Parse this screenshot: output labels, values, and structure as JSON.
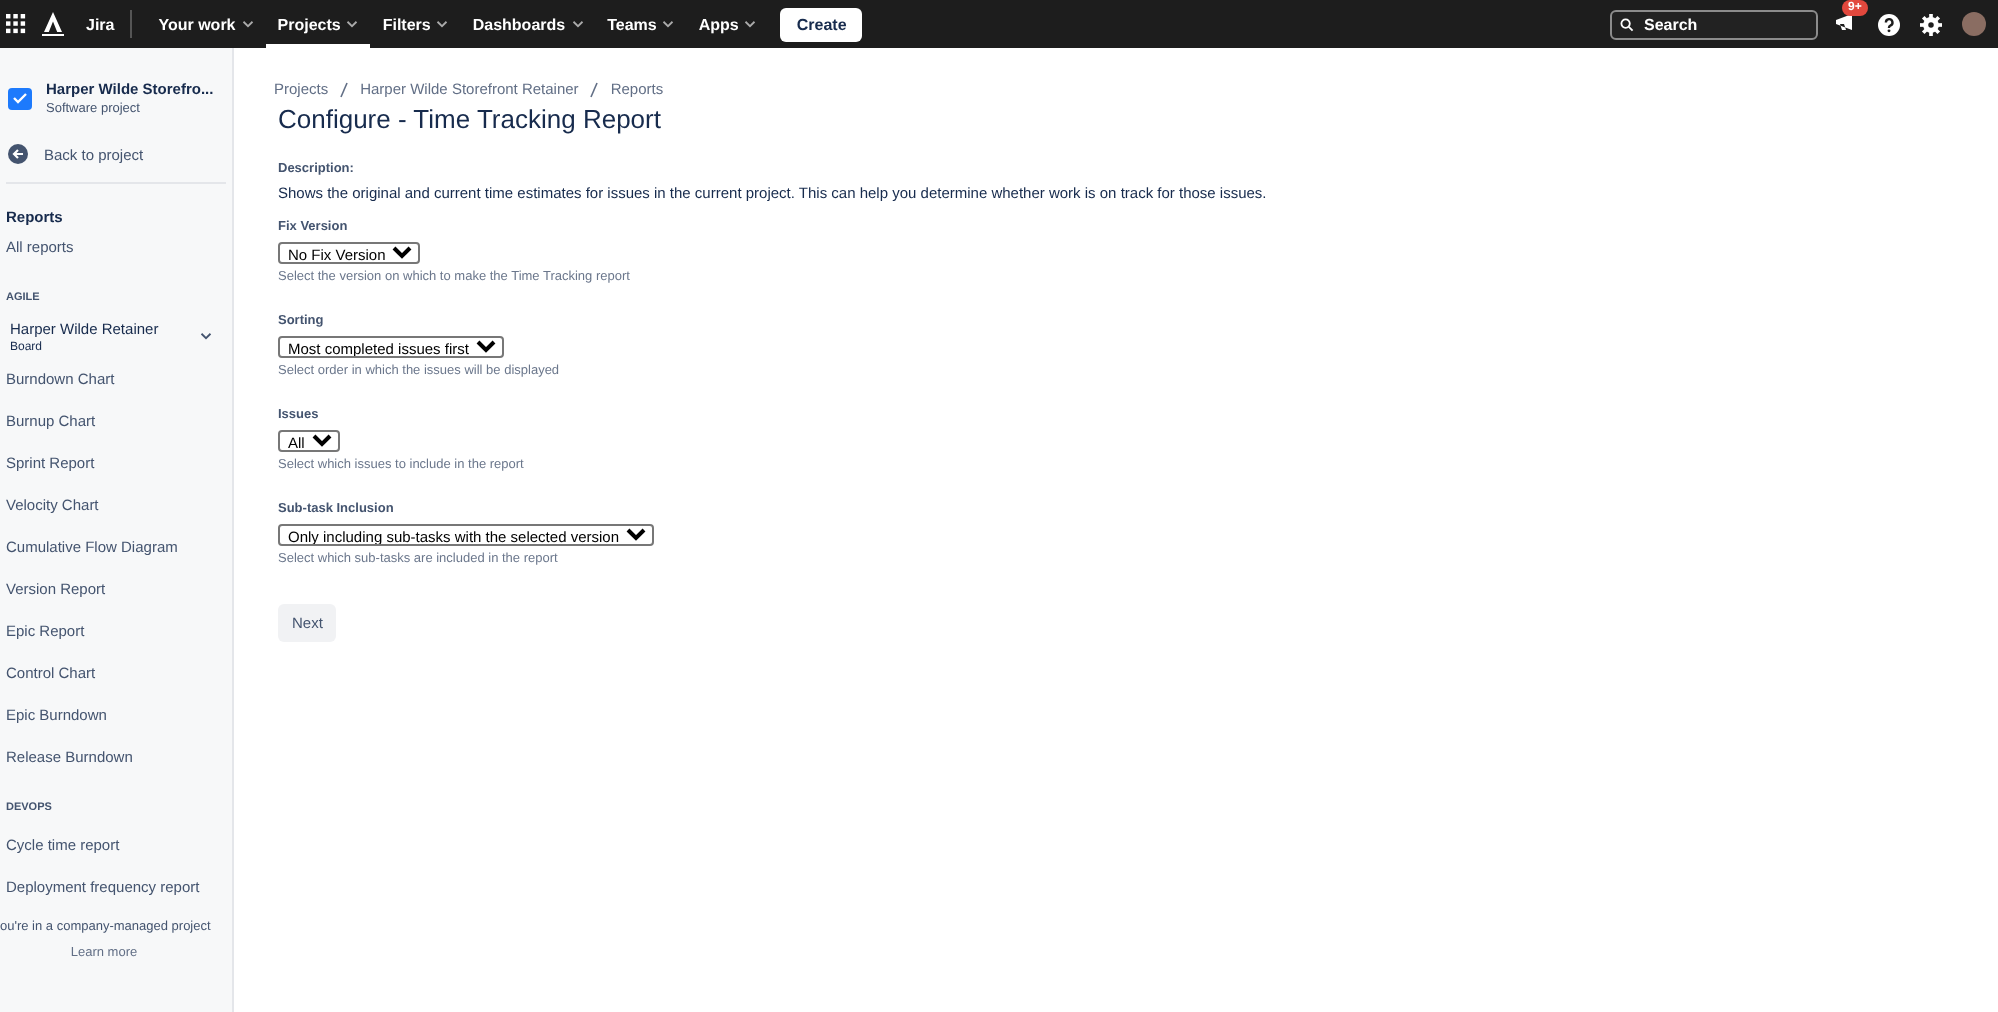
{
  "topbar": {
    "product": "Jira",
    "nav": [
      {
        "label": "Your work",
        "selected": false
      },
      {
        "label": "Projects",
        "selected": true
      },
      {
        "label": "Filters",
        "selected": false
      },
      {
        "label": "Dashboards",
        "selected": false
      },
      {
        "label": "Teams",
        "selected": false
      },
      {
        "label": "Apps",
        "selected": false
      }
    ],
    "create": "Create",
    "search": {
      "placeholder": "Search"
    },
    "notifications_badge": "9+"
  },
  "sidebar": {
    "project_name": "Harper Wilde Storefro...",
    "project_type": "Software project",
    "back": "Back to project",
    "heading": "Reports",
    "all_reports": "All reports",
    "sections": [
      {
        "title": "AGILE",
        "board": {
          "name": "Harper Wilde Retainer",
          "type": "Board"
        },
        "items": [
          "Burndown Chart",
          "Burnup Chart",
          "Sprint Report",
          "Velocity Chart",
          "Cumulative Flow Diagram",
          "Version Report",
          "Epic Report",
          "Control Chart",
          "Epic Burndown",
          "Release Burndown"
        ]
      },
      {
        "title": "DEVOPS",
        "items": [
          "Cycle time report",
          "Deployment frequency report"
        ]
      }
    ],
    "footer": "ou're in a company-managed project",
    "learn_more": "Learn more"
  },
  "breadcrumbs": [
    "Projects",
    "Harper Wilde Storefront Retainer",
    "Reports"
  ],
  "title": "Configure - Time Tracking Report",
  "description": {
    "label": "Description:",
    "text": "Shows the original and current time estimates for issues in the current project. This can help you determine whether work is on track for those issues."
  },
  "fields": [
    {
      "label": "Fix Version",
      "value": "No Fix Version",
      "hint": "Select the version on which to make the Time Tracking report"
    },
    {
      "label": "Sorting",
      "value": "Most completed issues first",
      "hint": "Select order in which the issues will be displayed"
    },
    {
      "label": "Issues",
      "value": "All",
      "hint": "Select which issues to include in the report"
    },
    {
      "label": "Sub-task Inclusion",
      "value": "Only including sub-tasks with the selected version",
      "hint": "Select which sub-tasks are included in the report"
    }
  ],
  "next_button": "Next"
}
